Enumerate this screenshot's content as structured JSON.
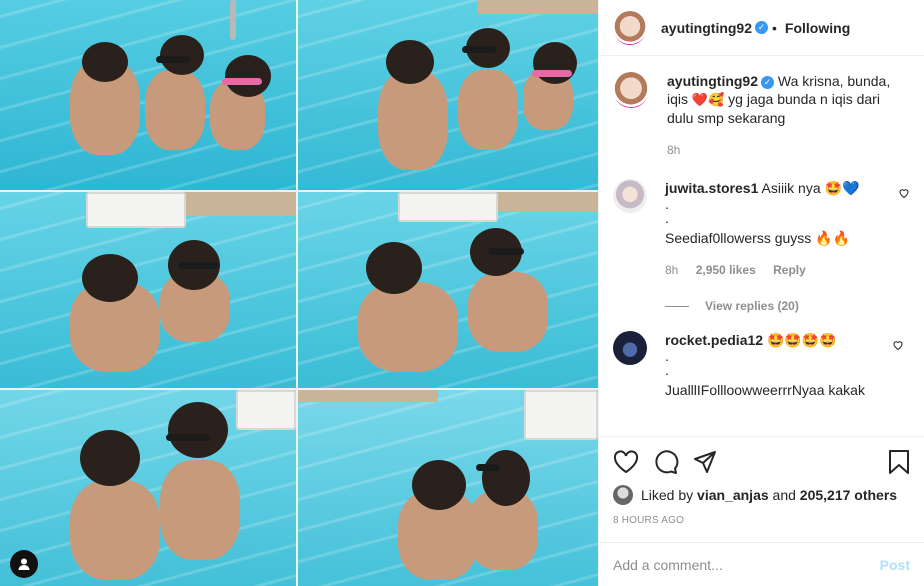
{
  "header": {
    "username": "ayutingting92",
    "verified_mark": "✓",
    "separator": "•",
    "follow_status": "Following"
  },
  "caption": {
    "username": "ayutingting92",
    "text_before": "Wa krisna, bunda, iqis",
    "emojis": "❤️🥰",
    "text_after": "yg jaga bunda n iqis dari dulu smp sekarang",
    "time": "8h"
  },
  "comments": [
    {
      "username": "juwita.stores1",
      "line1": "Asiiik nya 🤩💙",
      "dots": [
        ".",
        "."
      ],
      "line2": "Seediaf0llowerss guyss 🔥🔥",
      "time": "8h",
      "likes": "2,950 likes",
      "reply": "Reply",
      "view_replies": "View replies (20)"
    },
    {
      "username": "rocket.pedia12",
      "line1": "🤩🤩🤩🤩",
      "dots": [
        ".",
        "."
      ],
      "line2": "JualllIFollloowweerrrNyaa kakak"
    }
  ],
  "actions": {
    "like_icon": "heart-icon",
    "comment_icon": "comment-icon",
    "share_icon": "share-icon",
    "save_icon": "bookmark-icon"
  },
  "likes": {
    "prefix": "Liked by",
    "user": "vian_anjas",
    "and": "and",
    "others": "205,217 others"
  },
  "posted": "8 HOURS AGO",
  "add_comment": {
    "placeholder": "Add a comment...",
    "post_label": "Post"
  },
  "colors": {
    "water": "#3fc3dc",
    "water_light": "#7fd9ea",
    "link_blue": "#3897f0",
    "post_disabled": "#b2dffc"
  }
}
